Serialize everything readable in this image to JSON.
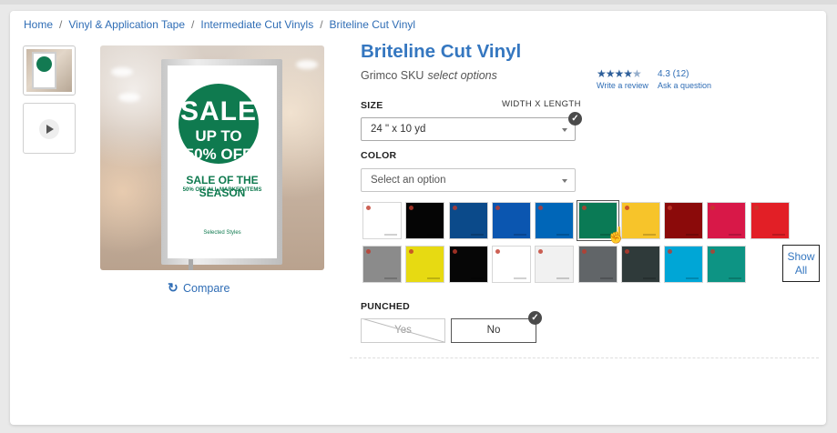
{
  "breadcrumbs": [
    "Home",
    "Vinyl & Application Tape",
    "Intermediate Cut Vinyls",
    "Briteline Cut Vinyl"
  ],
  "gallery": {
    "hero": {
      "sale_word": "SALE",
      "sale_offer": "UP TO 50% OFF",
      "headline": "SALE OF THE SEASON",
      "subline": "50% OFF ALL MARKED ITEMS",
      "footer": "Selected Styles"
    }
  },
  "compare_label": "Compare",
  "product": {
    "title": "Briteline Cut Vinyl",
    "sku_label": "Grimco SKU",
    "sku_value": "select options",
    "rating_text": "4.3 (12)",
    "rating_value": 4.3,
    "write_review": "Write a review",
    "ask_question": "Ask a question"
  },
  "size": {
    "label": "SIZE",
    "hint": "WIDTH X LENGTH",
    "selected": "24 \" x 10 yd"
  },
  "color": {
    "label": "COLOR",
    "placeholder": "Select an option",
    "swatches": [
      "#ffffff",
      "#050505",
      "#0b4a8a",
      "#0b56b0",
      "#0066b8",
      "#0a7a55",
      "#f7c42a",
      "#8b0a0a",
      "#d81848",
      "#e21f26",
      "#8b8b8b",
      "#e7da12",
      "#060606",
      "#ffffff",
      "#f1f1f1",
      "#616568",
      "#2f3a3a",
      "#00a6d6",
      "#0d9484"
    ],
    "selected_index": 5,
    "show_all": "Show All"
  },
  "punched": {
    "label": "PUNCHED",
    "options": [
      "Yes",
      "No"
    ],
    "selected": "No"
  },
  "accent_color": "#3577c0"
}
